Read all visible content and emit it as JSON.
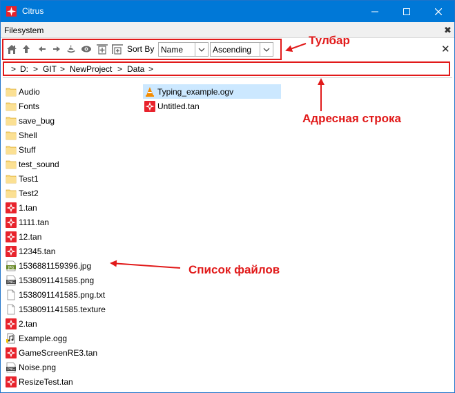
{
  "window": {
    "title": "Citrus"
  },
  "panel": {
    "title": "Filesystem"
  },
  "toolbar": {
    "sort_by_label": "Sort By",
    "sort_field": "Name",
    "sort_order": "Ascending",
    "icons": [
      "home-icon",
      "up-icon",
      "back-icon",
      "forward-icon",
      "refresh-icon",
      "show-hidden-icon",
      "new-folder-icon",
      "new-file-icon"
    ]
  },
  "address": {
    "crumbs": [
      ">",
      "D:",
      ">",
      "GIT",
      ">",
      "NewProject",
      ">",
      "Data",
      ">"
    ]
  },
  "files": {
    "column1": [
      {
        "name": "Audio",
        "type": "folder"
      },
      {
        "name": "Fonts",
        "type": "folder"
      },
      {
        "name": "save_bug",
        "type": "folder"
      },
      {
        "name": "Shell",
        "type": "folder"
      },
      {
        "name": "Stuff",
        "type": "folder"
      },
      {
        "name": "test_sound",
        "type": "folder"
      },
      {
        "name": "Test1",
        "type": "folder"
      },
      {
        "name": "Test2",
        "type": "folder"
      },
      {
        "name": "1.tan",
        "type": "tan"
      },
      {
        "name": "1111.tan",
        "type": "tan"
      },
      {
        "name": "12.tan",
        "type": "tan"
      },
      {
        "name": "12345.tan",
        "type": "tan"
      },
      {
        "name": "1536881159396.jpg",
        "type": "jpg"
      },
      {
        "name": "1538091141585.png",
        "type": "png"
      },
      {
        "name": "1538091141585.png.txt",
        "type": "txt"
      },
      {
        "name": "1538091141585.texture",
        "type": "txt"
      },
      {
        "name": "2.tan",
        "type": "tan"
      },
      {
        "name": "Example.ogg",
        "type": "ogg"
      },
      {
        "name": "GameScreenRE3.tan",
        "type": "tan"
      },
      {
        "name": "Noise.png",
        "type": "png"
      },
      {
        "name": "ResizeTest.tan",
        "type": "tan"
      }
    ],
    "column2": [
      {
        "name": "Typing_example.ogv",
        "type": "vlc",
        "selected": true
      },
      {
        "name": "Untitled.tan",
        "type": "tan"
      }
    ]
  },
  "annotations": {
    "toolbar": "Тулбар",
    "address_bar": "Адресная строка",
    "file_list": "Список файлов"
  },
  "colors": {
    "titlebar": "#0078d7",
    "annotation": "#e11a1a",
    "selection": "#cce8ff",
    "folder": "#f8d775"
  }
}
